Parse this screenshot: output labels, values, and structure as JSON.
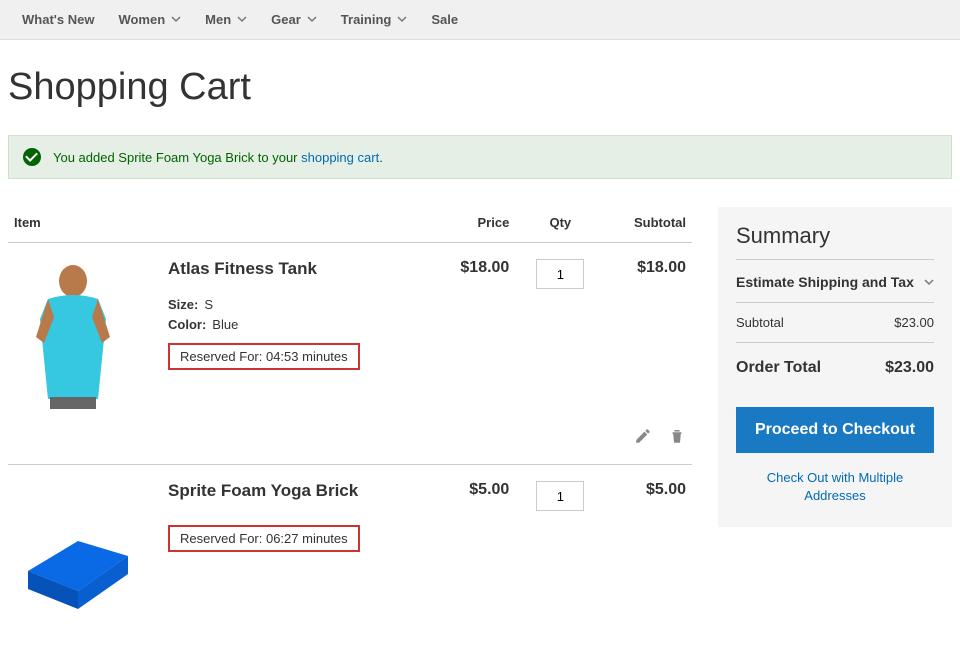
{
  "nav": {
    "whats_new": "What's New",
    "women": "Women",
    "men": "Men",
    "gear": "Gear",
    "training": "Training",
    "sale": "Sale"
  },
  "page_title": "Shopping Cart",
  "success": {
    "pre": "You added Sprite Foam Yoga Brick to your ",
    "link": "shopping cart",
    "post": "."
  },
  "headers": {
    "item": "Item",
    "price": "Price",
    "qty": "Qty",
    "subtotal": "Subtotal"
  },
  "items": [
    {
      "name": "Atlas Fitness Tank",
      "options": {
        "size_k": "Size:",
        "size_v": "S",
        "color_k": "Color:",
        "color_v": "Blue"
      },
      "reserved": "Reserved For: 04:53 minutes",
      "price": "$18.00",
      "qty": "1",
      "subtotal": "$18.00",
      "thumb": "tank",
      "has_actions": true,
      "has_options": true
    },
    {
      "name": "Sprite Foam Yoga Brick",
      "reserved": "Reserved For: 06:27 minutes",
      "price": "$5.00",
      "qty": "1",
      "subtotal": "$5.00",
      "thumb": "brick",
      "has_actions": false,
      "has_options": false
    }
  ],
  "summary": {
    "title": "Summary",
    "estimate": "Estimate Shipping and Tax",
    "subtotal_k": "Subtotal",
    "subtotal_v": "$23.00",
    "total_k": "Order Total",
    "total_v": "$23.00",
    "checkout": "Proceed to Checkout",
    "multi": "Check Out with Multiple Addresses"
  }
}
